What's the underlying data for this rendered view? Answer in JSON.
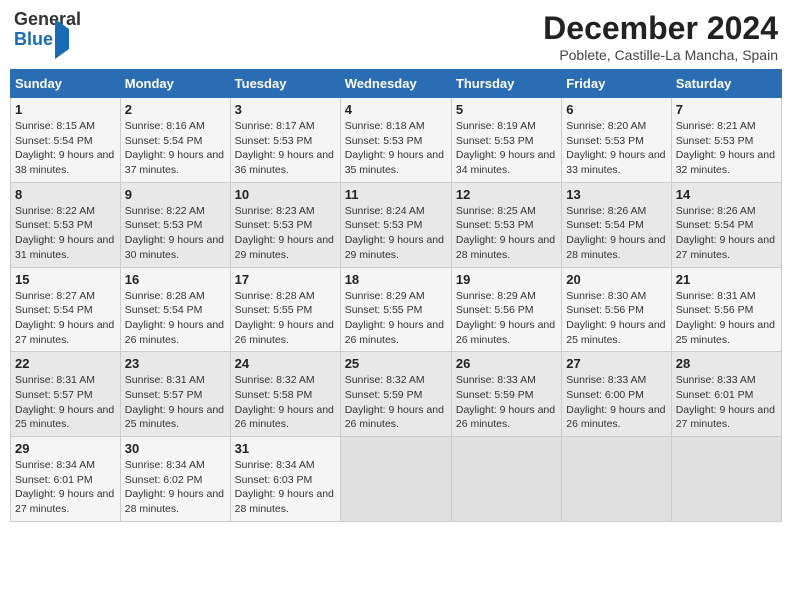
{
  "header": {
    "logo_line1": "General",
    "logo_line2": "Blue",
    "month_title": "December 2024",
    "location": "Poblete, Castille-La Mancha, Spain"
  },
  "weekdays": [
    "Sunday",
    "Monday",
    "Tuesday",
    "Wednesday",
    "Thursday",
    "Friday",
    "Saturday"
  ],
  "weeks": [
    [
      {
        "day": "1",
        "sunrise": "8:15 AM",
        "sunset": "5:54 PM",
        "daylight": "9 hours and 38 minutes."
      },
      {
        "day": "2",
        "sunrise": "8:16 AM",
        "sunset": "5:54 PM",
        "daylight": "9 hours and 37 minutes."
      },
      {
        "day": "3",
        "sunrise": "8:17 AM",
        "sunset": "5:53 PM",
        "daylight": "9 hours and 36 minutes."
      },
      {
        "day": "4",
        "sunrise": "8:18 AM",
        "sunset": "5:53 PM",
        "daylight": "9 hours and 35 minutes."
      },
      {
        "day": "5",
        "sunrise": "8:19 AM",
        "sunset": "5:53 PM",
        "daylight": "9 hours and 34 minutes."
      },
      {
        "day": "6",
        "sunrise": "8:20 AM",
        "sunset": "5:53 PM",
        "daylight": "9 hours and 33 minutes."
      },
      {
        "day": "7",
        "sunrise": "8:21 AM",
        "sunset": "5:53 PM",
        "daylight": "9 hours and 32 minutes."
      }
    ],
    [
      {
        "day": "8",
        "sunrise": "8:22 AM",
        "sunset": "5:53 PM",
        "daylight": "9 hours and 31 minutes."
      },
      {
        "day": "9",
        "sunrise": "8:22 AM",
        "sunset": "5:53 PM",
        "daylight": "9 hours and 30 minutes."
      },
      {
        "day": "10",
        "sunrise": "8:23 AM",
        "sunset": "5:53 PM",
        "daylight": "9 hours and 29 minutes."
      },
      {
        "day": "11",
        "sunrise": "8:24 AM",
        "sunset": "5:53 PM",
        "daylight": "9 hours and 29 minutes."
      },
      {
        "day": "12",
        "sunrise": "8:25 AM",
        "sunset": "5:53 PM",
        "daylight": "9 hours and 28 minutes."
      },
      {
        "day": "13",
        "sunrise": "8:26 AM",
        "sunset": "5:54 PM",
        "daylight": "9 hours and 28 minutes."
      },
      {
        "day": "14",
        "sunrise": "8:26 AM",
        "sunset": "5:54 PM",
        "daylight": "9 hours and 27 minutes."
      }
    ],
    [
      {
        "day": "15",
        "sunrise": "8:27 AM",
        "sunset": "5:54 PM",
        "daylight": "9 hours and 27 minutes."
      },
      {
        "day": "16",
        "sunrise": "8:28 AM",
        "sunset": "5:54 PM",
        "daylight": "9 hours and 26 minutes."
      },
      {
        "day": "17",
        "sunrise": "8:28 AM",
        "sunset": "5:55 PM",
        "daylight": "9 hours and 26 minutes."
      },
      {
        "day": "18",
        "sunrise": "8:29 AM",
        "sunset": "5:55 PM",
        "daylight": "9 hours and 26 minutes."
      },
      {
        "day": "19",
        "sunrise": "8:29 AM",
        "sunset": "5:56 PM",
        "daylight": "9 hours and 26 minutes."
      },
      {
        "day": "20",
        "sunrise": "8:30 AM",
        "sunset": "5:56 PM",
        "daylight": "9 hours and 25 minutes."
      },
      {
        "day": "21",
        "sunrise": "8:31 AM",
        "sunset": "5:56 PM",
        "daylight": "9 hours and 25 minutes."
      }
    ],
    [
      {
        "day": "22",
        "sunrise": "8:31 AM",
        "sunset": "5:57 PM",
        "daylight": "9 hours and 25 minutes."
      },
      {
        "day": "23",
        "sunrise": "8:31 AM",
        "sunset": "5:57 PM",
        "daylight": "9 hours and 25 minutes."
      },
      {
        "day": "24",
        "sunrise": "8:32 AM",
        "sunset": "5:58 PM",
        "daylight": "9 hours and 26 minutes."
      },
      {
        "day": "25",
        "sunrise": "8:32 AM",
        "sunset": "5:59 PM",
        "daylight": "9 hours and 26 minutes."
      },
      {
        "day": "26",
        "sunrise": "8:33 AM",
        "sunset": "5:59 PM",
        "daylight": "9 hours and 26 minutes."
      },
      {
        "day": "27",
        "sunrise": "8:33 AM",
        "sunset": "6:00 PM",
        "daylight": "9 hours and 26 minutes."
      },
      {
        "day": "28",
        "sunrise": "8:33 AM",
        "sunset": "6:01 PM",
        "daylight": "9 hours and 27 minutes."
      }
    ],
    [
      {
        "day": "29",
        "sunrise": "8:34 AM",
        "sunset": "6:01 PM",
        "daylight": "9 hours and 27 minutes."
      },
      {
        "day": "30",
        "sunrise": "8:34 AM",
        "sunset": "6:02 PM",
        "daylight": "9 hours and 28 minutes."
      },
      {
        "day": "31",
        "sunrise": "8:34 AM",
        "sunset": "6:03 PM",
        "daylight": "9 hours and 28 minutes."
      },
      null,
      null,
      null,
      null
    ]
  ]
}
